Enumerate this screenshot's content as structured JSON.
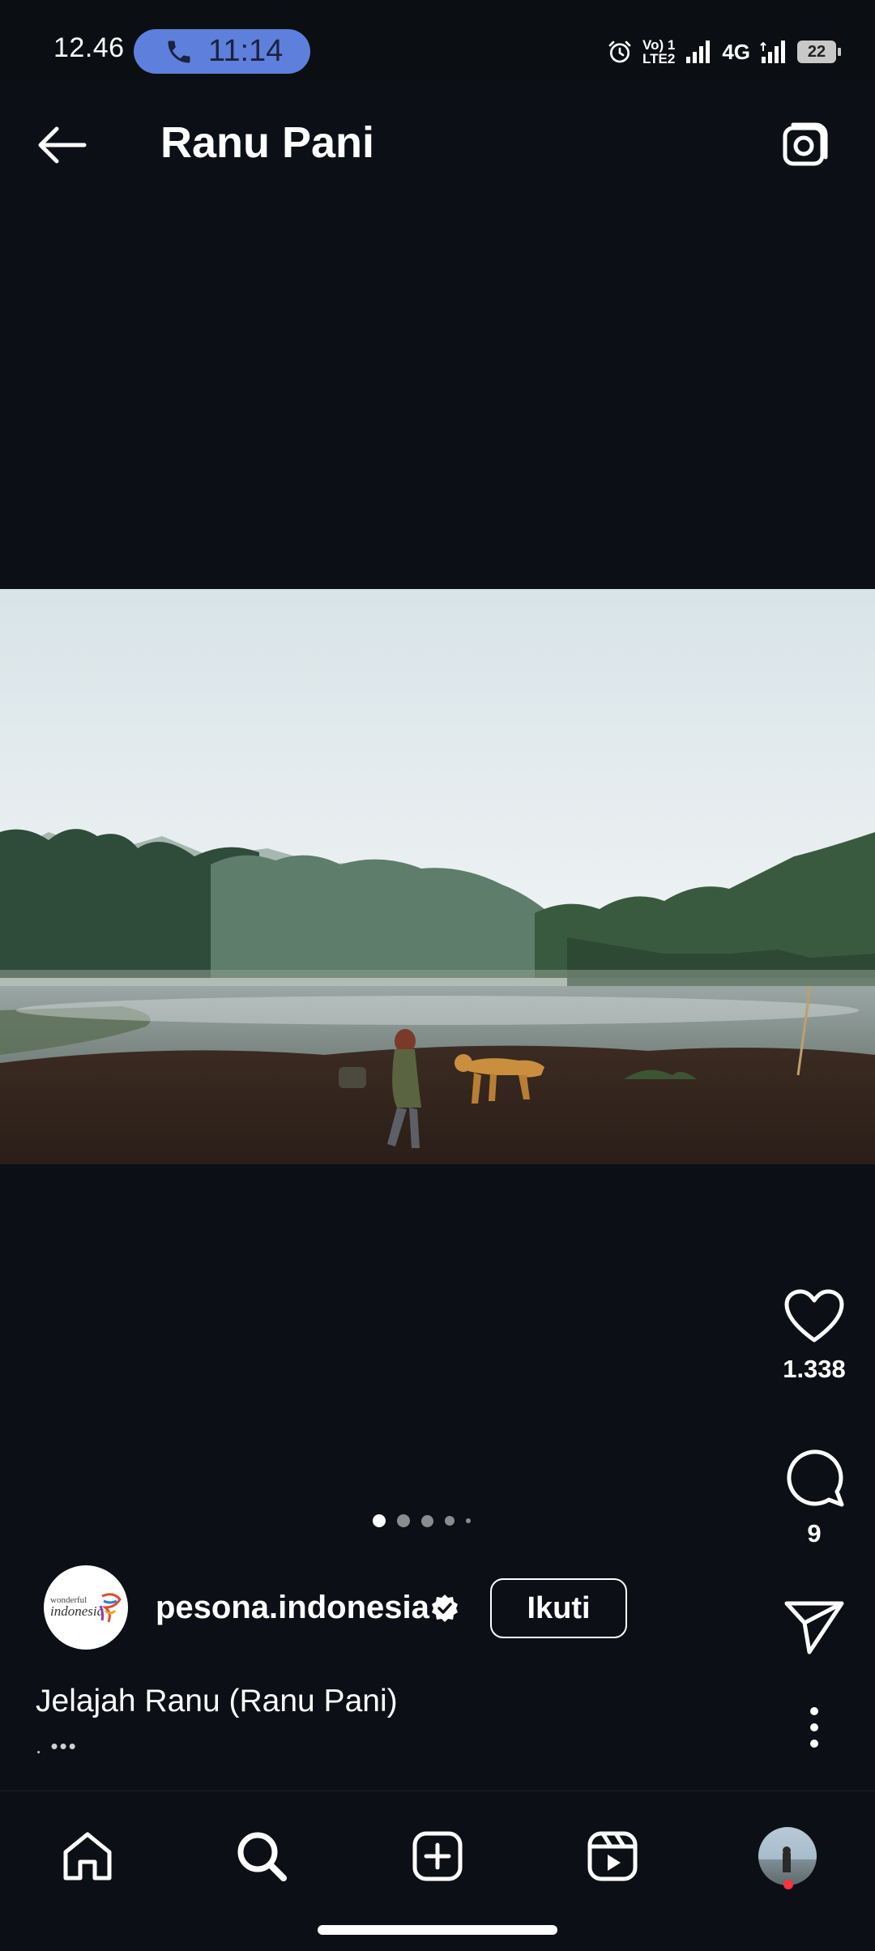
{
  "status_bar": {
    "time": "12.46",
    "call_timer": "11:14",
    "network": "4G",
    "volte_top": "Vo) 1",
    "volte_bottom": "LTE2",
    "battery": "22"
  },
  "header": {
    "title": "Ranu Pani",
    "back_icon": "back-arrow-icon",
    "camera_icon": "camera-icon"
  },
  "post": {
    "likes": "1.338",
    "comments": "9",
    "carousel": {
      "total": 5,
      "active": 1
    },
    "author": {
      "username": "pesona.indonesia",
      "verified": true,
      "avatar_logo_line1": "wonderful",
      "avatar_logo_line2": "indonesia"
    },
    "follow_label": "Ikuti",
    "caption": "Jelajah Ranu (Ranu Pani)",
    "caption_more": ". •••"
  },
  "nav": {
    "items": [
      {
        "name": "home",
        "icon": "home-icon"
      },
      {
        "name": "search",
        "icon": "search-icon"
      },
      {
        "name": "create",
        "icon": "plus-square-icon"
      },
      {
        "name": "reels",
        "icon": "reels-icon"
      },
      {
        "name": "profile",
        "icon": "profile-avatar",
        "notification": true
      }
    ]
  },
  "colors": {
    "background": "#0c0f15",
    "call_pill": "#5f7fdc",
    "notification_dot": "#ff3040"
  }
}
